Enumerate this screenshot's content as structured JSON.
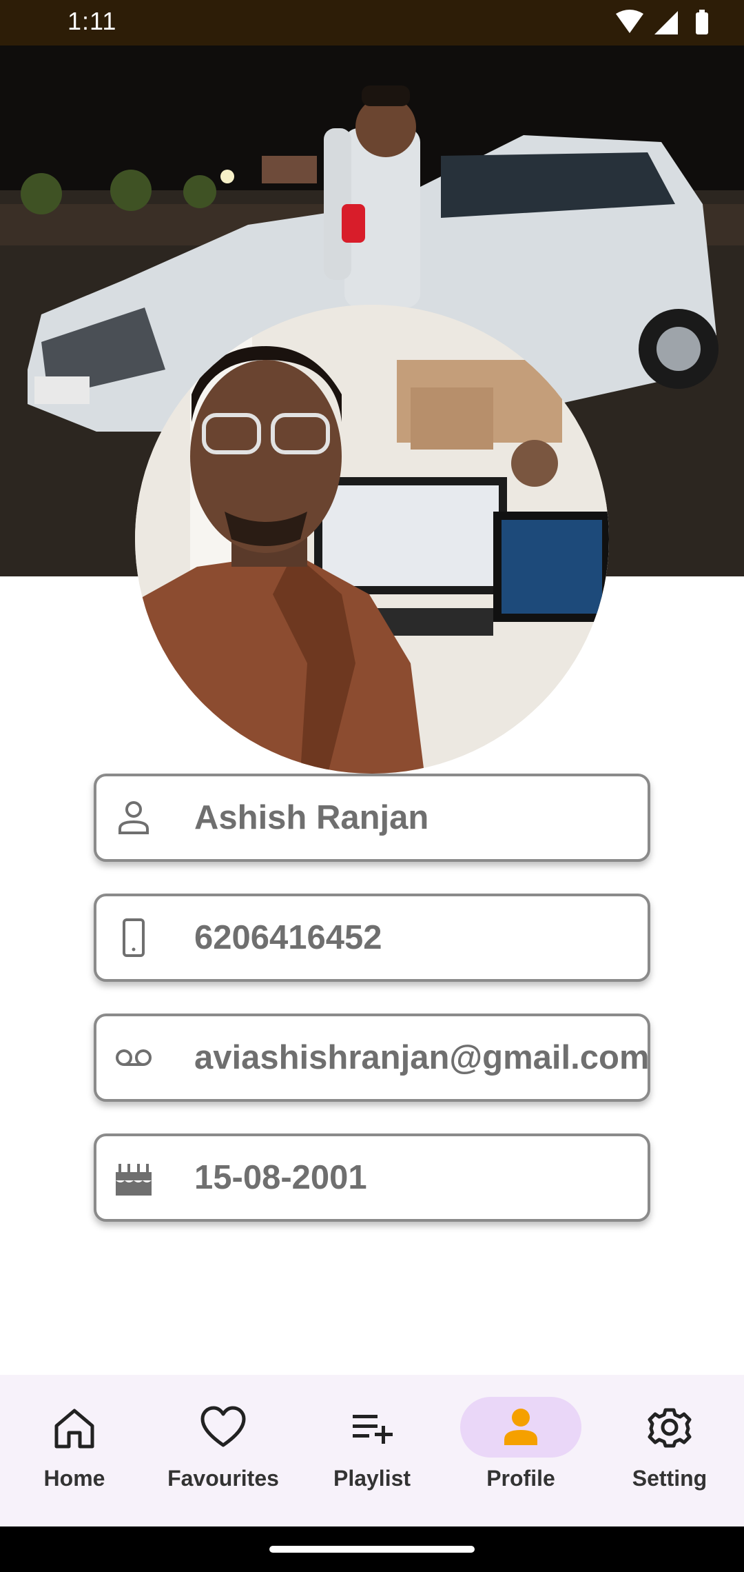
{
  "status_bar": {
    "time": "1:11",
    "icons": [
      "wifi-icon",
      "signal-icon",
      "battery-icon"
    ]
  },
  "profile": {
    "cover_image": "cover-photo-man-standing-by-white-suv-at-night",
    "avatar_image": "selfie-man-in-brown-leather-jacket-at-office-desk",
    "fields": [
      {
        "id": "name",
        "icon": "person-icon",
        "value": "Ashish Ranjan"
      },
      {
        "id": "phone",
        "icon": "smartphone-icon",
        "value": "6206416452"
      },
      {
        "id": "email",
        "icon": "voicemail-icon",
        "value": "aviashishranjan@gmail.com"
      },
      {
        "id": "dob",
        "icon": "cake-icon",
        "value": "15-08-2001"
      }
    ]
  },
  "bottom_nav": {
    "items": [
      {
        "label": "Home",
        "icon": "home-icon",
        "selected": false
      },
      {
        "label": "Favourites",
        "icon": "heart-icon",
        "selected": false
      },
      {
        "label": "Playlist",
        "icon": "playlist-add-icon",
        "selected": false
      },
      {
        "label": "Profile",
        "icon": "person-filled-icon",
        "selected": true
      },
      {
        "label": "Setting",
        "icon": "gear-icon",
        "selected": false
      }
    ]
  },
  "colors": {
    "status_bar_bg": "#2d1d07",
    "field_text": "#6f6f6f",
    "field_border": "#8a8a8a",
    "nav_bg": "#f7f2fa",
    "nav_selected_pill": "#ead7f8",
    "profile_icon_accent": "#f5a000"
  }
}
